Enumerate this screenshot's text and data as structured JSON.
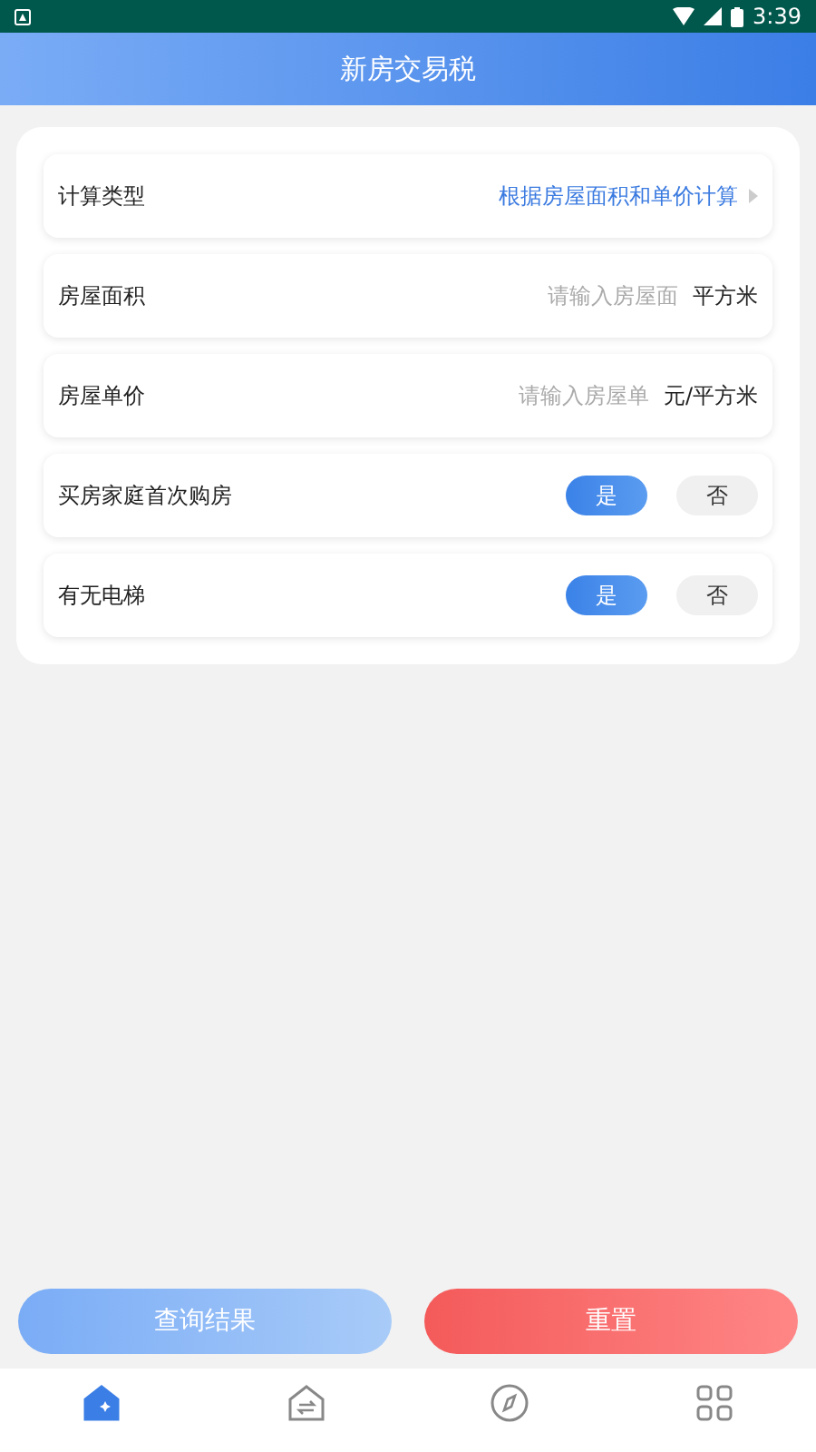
{
  "status_bar": {
    "time": "3:39"
  },
  "header": {
    "title": "新房交易税"
  },
  "form": {
    "rows": [
      {
        "kind": "select",
        "label": "计算类型",
        "value": "根据房屋面积和单价计算"
      },
      {
        "kind": "input",
        "label": "房屋面积",
        "placeholder": "请输入房屋面",
        "unit": "平方米"
      },
      {
        "kind": "input",
        "label": "房屋单价",
        "placeholder": "请输入房屋单",
        "unit": "元/平方米"
      },
      {
        "kind": "choice",
        "label": "买房家庭首次购房",
        "options": [
          {
            "label": "是",
            "selected": true
          },
          {
            "label": "否",
            "selected": false
          }
        ]
      },
      {
        "kind": "choice",
        "label": "有无电梯",
        "options": [
          {
            "label": "是",
            "selected": true
          },
          {
            "label": "否",
            "selected": false
          }
        ]
      }
    ]
  },
  "actions": {
    "query": "查询结果",
    "reset": "重置"
  },
  "tab_bar": [
    {
      "kind": "home",
      "selected": true
    },
    {
      "kind": "exchange",
      "selected": false
    },
    {
      "kind": "compass",
      "selected": false
    },
    {
      "kind": "grid",
      "selected": false
    }
  ]
}
